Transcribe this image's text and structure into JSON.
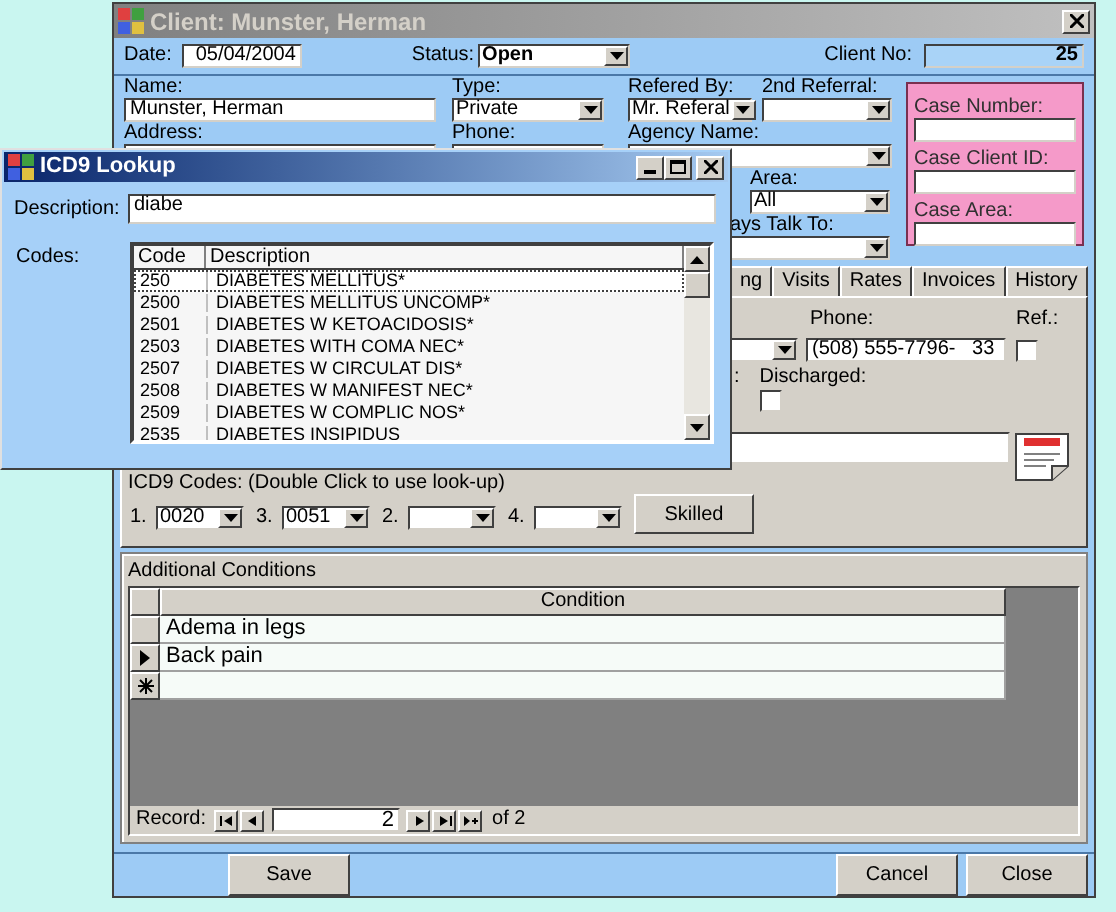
{
  "client_window": {
    "title": "Client: Munster, Herman",
    "date_label": "Date:",
    "date": "05/04/2004",
    "status_label": "Status:",
    "status": "Open",
    "client_no_label": "Client No:",
    "client_no": "25",
    "name_label": "Name:",
    "name": "Munster, Herman",
    "type_label": "Type:",
    "type": "Private",
    "referred_by_label": "Refered By:",
    "referred_by": "Mr. Referal",
    "second_referral_label": "2nd Referral:",
    "address_label": "Address:",
    "phone_label": "Phone:",
    "agency_label": "Agency Name:",
    "area_label": "Area:",
    "area": "All",
    "talk_to_label": "ays Talk To:",
    "case_box": {
      "labels": [
        "Case Number:",
        "Case Client ID:",
        "Case Area:"
      ]
    },
    "tabs": [
      {
        "label": "ng",
        "selected": false
      },
      {
        "label": "Visits",
        "selected": false
      },
      {
        "label": "Rates",
        "selected": false
      },
      {
        "label": "Invoices",
        "selected": false
      },
      {
        "label": "History",
        "selected": false
      }
    ],
    "tab_panel": {
      "phone_label": "Phone:",
      "ref_label": "Ref.:",
      "phone": "(508) 555-7796-   33",
      "ref_checked": false,
      "colon_label": ":",
      "discharged_label": "Discharged:",
      "discharged_checked": false,
      "icd9_label": "ICD9 Codes: (Double Click to use look-up)",
      "icd9_codes": [
        {
          "number": "1.",
          "value": "0020"
        },
        {
          "number": "3.",
          "value": "0051"
        },
        {
          "number": "2."
        },
        {
          "number": "4."
        }
      ],
      "skilled_button": {
        "label": "Skilled"
      }
    },
    "additional_conditions": {
      "title": "Additional Conditions",
      "columns": [
        "Condition"
      ],
      "rows": [
        {
          "condition": "Adema in legs",
          "current": false
        },
        {
          "condition": "Back pain",
          "current": true
        }
      ],
      "record_label": "Record:",
      "record": "2",
      "record_total": "of 2"
    },
    "left_buttons": [
      {
        "label": "Save"
      }
    ],
    "right_buttons": [
      {
        "label": "Cancel"
      },
      {
        "label": "Close"
      }
    ]
  },
  "icd9_lookup": {
    "title": "ICD9 Lookup",
    "description_label": "Description:",
    "description": "diabe",
    "codes_label": "Codes:",
    "columns": [
      "Code",
      "Description"
    ],
    "rows": [
      {
        "code": "250",
        "description": "DIABETES MELLITUS*",
        "selected": true
      },
      {
        "code": "2500",
        "description": "DIABETES MELLITUS UNCOMP*",
        "selected": false
      },
      {
        "code": "2501",
        "description": "DIABETES W KETOACIDOSIS*",
        "selected": false
      },
      {
        "code": "2503",
        "description": "DIABETES WITH COMA NEC*",
        "selected": false
      },
      {
        "code": "2507",
        "description": "DIABETES W CIRCULAT DIS*",
        "selected": false
      },
      {
        "code": "2508",
        "description": "DIABETES W MANIFEST NEC*",
        "selected": false
      },
      {
        "code": "2509",
        "description": "DIABETES W COMPLIC NOS*",
        "selected": false
      },
      {
        "code": "2535",
        "description": "DIABETES INSIPIDUS",
        "selected": false
      }
    ]
  }
}
